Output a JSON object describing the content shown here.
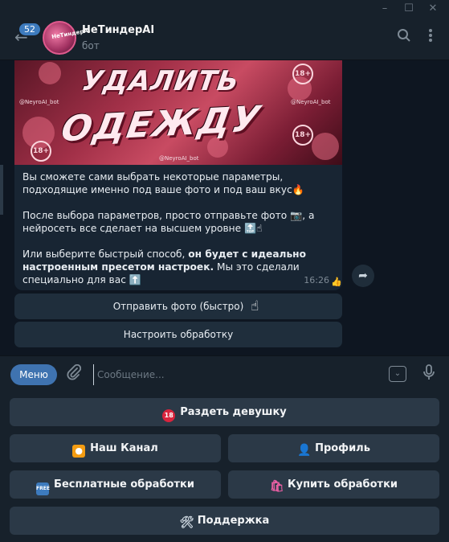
{
  "window": {
    "minimize": "–",
    "maximize": "☐",
    "close": "✕"
  },
  "header": {
    "back_count": "52",
    "chat_title": "НеТиндерAI",
    "chat_subtitle": "бот"
  },
  "banner": {
    "line1": "УДАЛИТЬ",
    "line2": "ОДЕЖДУ",
    "watermark": "@NeyroAI_bot",
    "badge": "18+"
  },
  "message": {
    "para1": "Вы сможете сами выбрать некоторые параметры, подходящие именно под ваше фото и под ваш вкус🔥",
    "para2": "После выбора параметров, просто отправьте фото 📷, а нейросеть все сделает на высшем уровне 🔝☝",
    "para3_start": "Или выберите быстрый способ, ",
    "para3_bold": "он будет с идеально настроенным пресетом настроек.",
    "para3_end": " Мы это сделали специально для вас ⬆️",
    "time": "16:26",
    "reaction": "👍"
  },
  "inline_buttons": {
    "send_fast": "Отправить фото (быстро)",
    "configure": "Настроить обработку"
  },
  "composer": {
    "menu": "Меню",
    "placeholder": "Сообщение..."
  },
  "keyboard": {
    "undress": "Раздеть девушку",
    "channel": "Наш Канал",
    "profile": "Профиль",
    "free": "Бесплатные обработки",
    "buy": "Купить обработки",
    "support": "Поддержка"
  },
  "colors": {
    "accent": "#3f73b0",
    "background": "#0e1621",
    "bubble": "#182533",
    "button": "#2b3947"
  }
}
